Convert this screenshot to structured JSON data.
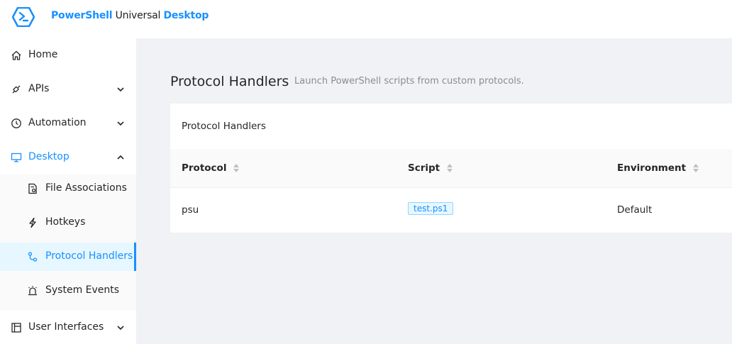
{
  "header": {
    "brand_part1": "PowerShell",
    "brand_part2": " Universal ",
    "brand_part3": "Desktop",
    "logo_icon": "powershell-logo-icon"
  },
  "sidebar": {
    "items": [
      {
        "label": "Home",
        "icon": "home-icon"
      },
      {
        "label": "APIs",
        "icon": "api-icon"
      },
      {
        "label": "Automation",
        "icon": "clock-icon"
      },
      {
        "label": "Desktop",
        "icon": "desktop-icon"
      },
      {
        "label": "User Interfaces",
        "icon": "layout-icon"
      }
    ],
    "desktop_sub": [
      {
        "label": "File Associations",
        "icon": "file-icon"
      },
      {
        "label": "Hotkeys",
        "icon": "thunderbolt-icon"
      },
      {
        "label": "Protocol Handlers",
        "icon": "protocol-icon"
      },
      {
        "label": "System Events",
        "icon": "alert-icon"
      }
    ]
  },
  "main": {
    "title": "Protocol Handlers",
    "subtitle": "Launch PowerShell scripts from custom protocols.",
    "card_title": "Protocol Handlers",
    "columns": [
      "Protocol",
      "Script",
      "Environment"
    ],
    "rows": [
      {
        "protocol": "psu",
        "script": "test.ps1",
        "environment": "Default"
      }
    ]
  },
  "colors": {
    "accent": "#1890ff",
    "content_bg": "#f0f2f5",
    "submenu_bg": "#fafafa",
    "selected_bg": "#e6f7ff"
  }
}
